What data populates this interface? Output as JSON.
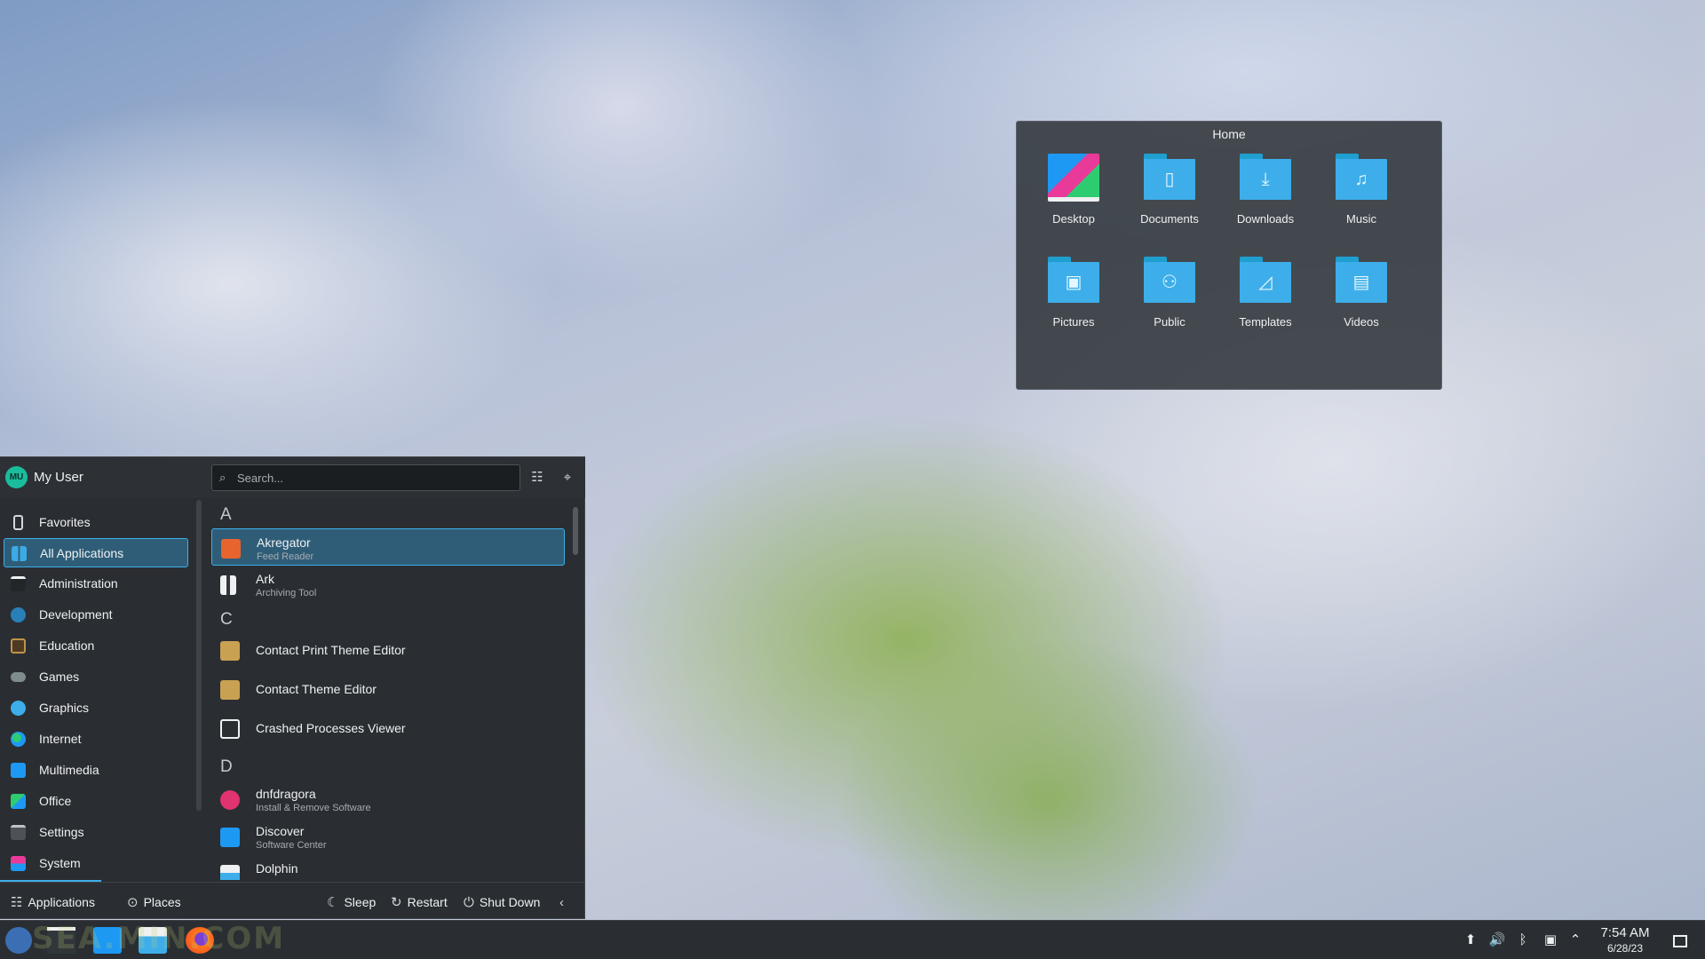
{
  "folder_widget": {
    "title": "Home",
    "items": [
      {
        "label": "Desktop",
        "icon": "desktop-folder-icon"
      },
      {
        "label": "Documents",
        "icon": "documents-folder-icon"
      },
      {
        "label": "Downloads",
        "icon": "downloads-folder-icon"
      },
      {
        "label": "Music",
        "icon": "music-folder-icon"
      },
      {
        "label": "Pictures",
        "icon": "pictures-folder-icon"
      },
      {
        "label": "Public",
        "icon": "public-folder-icon"
      },
      {
        "label": "Templates",
        "icon": "templates-folder-icon"
      },
      {
        "label": "Videos",
        "icon": "videos-folder-icon"
      }
    ]
  },
  "launcher": {
    "user": {
      "initials": "MU",
      "name": "My User"
    },
    "search": {
      "placeholder": "Search..."
    },
    "categories": [
      {
        "label": "Favorites",
        "icon": "bookmark-icon"
      },
      {
        "label": "All Applications",
        "icon": "grid-icon",
        "selected": true
      },
      {
        "label": "Administration",
        "icon": "administration-icon"
      },
      {
        "label": "Development",
        "icon": "development-icon"
      },
      {
        "label": "Education",
        "icon": "education-icon"
      },
      {
        "label": "Games",
        "icon": "gamepad-icon"
      },
      {
        "label": "Graphics",
        "icon": "graphics-icon"
      },
      {
        "label": "Internet",
        "icon": "globe-icon"
      },
      {
        "label": "Multimedia",
        "icon": "multimedia-icon"
      },
      {
        "label": "Office",
        "icon": "office-icon"
      },
      {
        "label": "Settings",
        "icon": "settings-icon"
      },
      {
        "label": "System",
        "icon": "system-icon"
      }
    ],
    "sections": [
      "A",
      "C",
      "D"
    ],
    "apps": [
      {
        "name": "Akregator",
        "desc": "Feed Reader",
        "icon": "rss-icon",
        "selected": true
      },
      {
        "name": "Ark",
        "desc": "Archiving Tool",
        "icon": "archive-icon"
      },
      {
        "name": "Contact Print Theme Editor",
        "desc": "",
        "icon": "contact-theme-icon"
      },
      {
        "name": "Contact Theme Editor",
        "desc": "",
        "icon": "contact-theme-icon"
      },
      {
        "name": "Crashed Processes Viewer",
        "desc": "",
        "icon": "crash-viewer-icon"
      },
      {
        "name": "dnfdragora",
        "desc": "Install & Remove Software",
        "icon": "package-icon"
      },
      {
        "name": "Discover",
        "desc": "Software Center",
        "icon": "discover-icon"
      },
      {
        "name": "Dolphin",
        "desc": "",
        "icon": "dolphin-icon"
      }
    ],
    "footer": {
      "applications": "Applications",
      "places": "Places",
      "sleep": "Sleep",
      "restart": "Restart",
      "shutdown": "Shut Down"
    }
  },
  "taskbar": {
    "clock_time": "7:54 AM",
    "clock_date": "6/28/23",
    "watermark": "SEA.MIN.COM"
  },
  "colors": {
    "accent": "#3daee9",
    "panel": "#2a2e32",
    "selection": "#2f5d78"
  }
}
